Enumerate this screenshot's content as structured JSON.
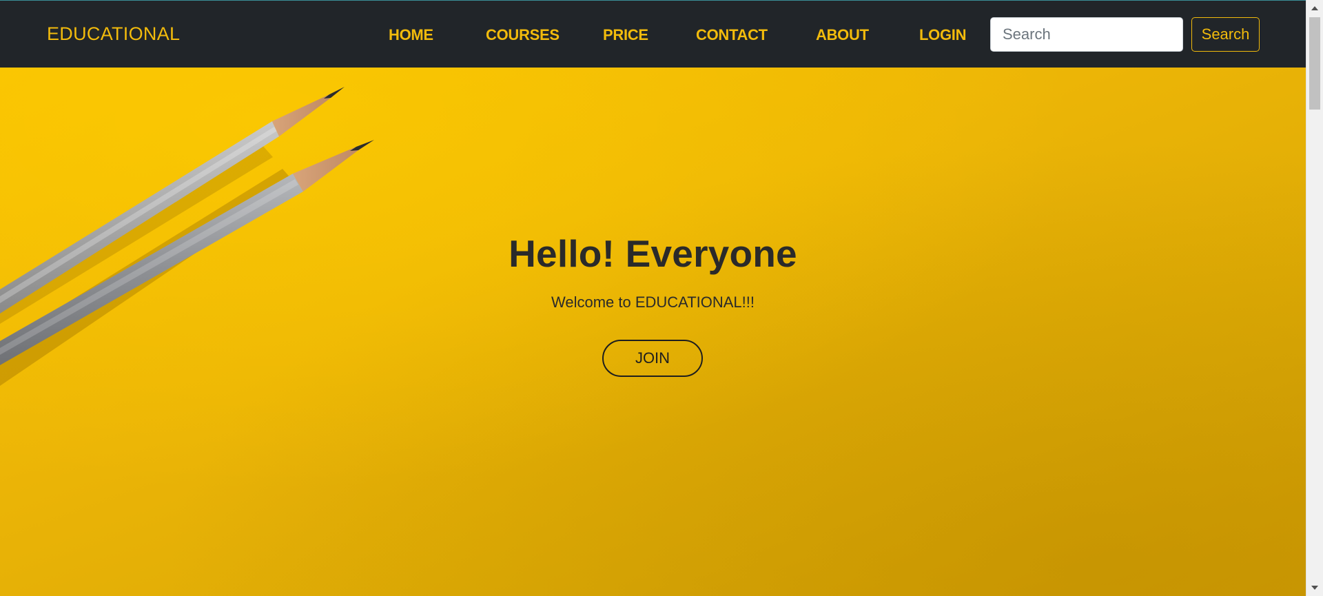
{
  "brand": {
    "name": "EDUCATIONAL"
  },
  "nav": {
    "items": [
      {
        "label": "HOME"
      },
      {
        "label": "COURSES"
      },
      {
        "label": "PRICE"
      },
      {
        "label": "CONTACT"
      },
      {
        "label": "ABOUT"
      },
      {
        "label": "LOGIN"
      }
    ]
  },
  "search": {
    "placeholder": "Search",
    "value": "",
    "button_label": "Search"
  },
  "hero": {
    "title": "Hello! Everyone",
    "subtitle": "Welcome to EDUCATIONAL!!!",
    "join_label": "JOIN",
    "background_image": "pencils-on-yellow-paper"
  },
  "colors": {
    "navbar_bg": "#212529",
    "accent_yellow": "#f2bb0c",
    "hero_bg": "#f0b705",
    "text_dark": "#2a2a2a"
  }
}
